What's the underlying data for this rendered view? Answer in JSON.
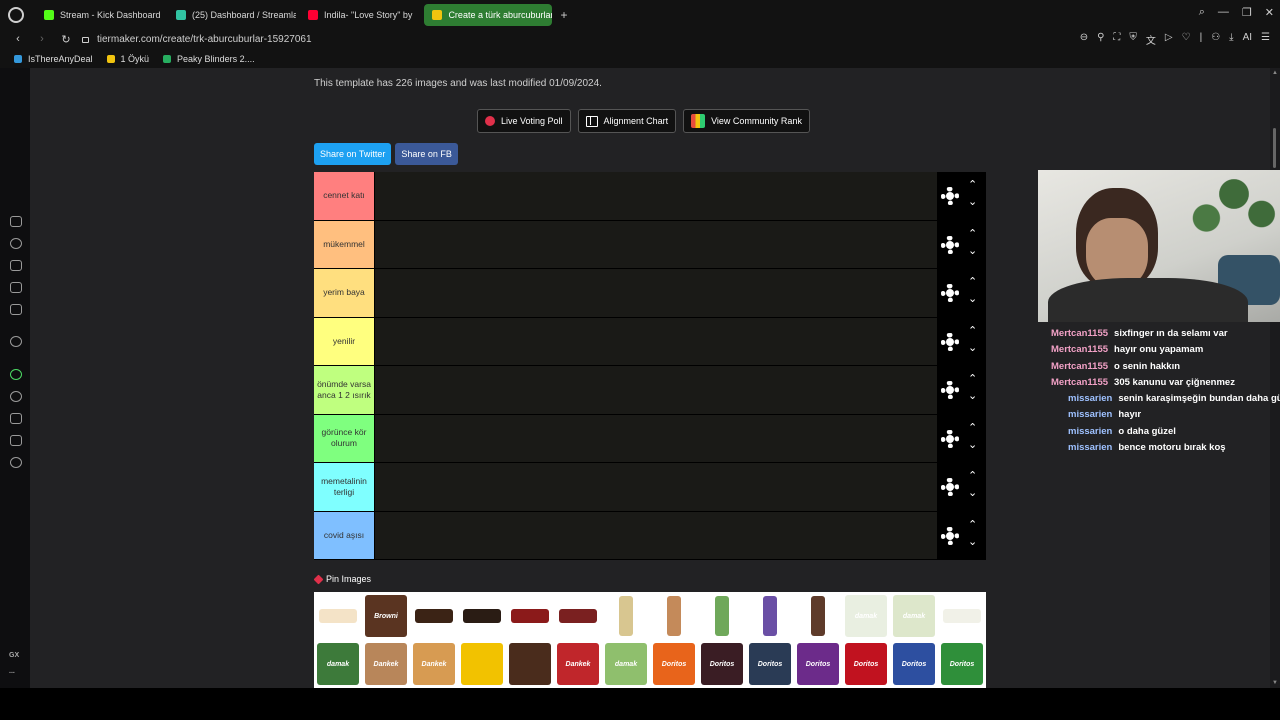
{
  "browser": {
    "tabs": [
      {
        "label": "Stream - Kick Dashboard",
        "color": "#53fc18",
        "active": false
      },
      {
        "label": "(25) Dashboard / Streamlabs",
        "color": "#31c3a2",
        "active": false
      },
      {
        "label": "Indila- \"Love Story\" by",
        "color": "#ff0033",
        "active": false
      },
      {
        "label": "Create a türk aburcuburlar",
        "color": "#f1c40f",
        "active": true
      }
    ],
    "new_tab": "+",
    "url": "tiermaker.com/create/trk-aburcuburlar-15927061",
    "ai_label": "AI",
    "bookmarks": [
      {
        "label": "IsThereAnyDeal",
        "color": "#3498db"
      },
      {
        "label": "1 Öykü",
        "color": "#f1c40f"
      },
      {
        "label": "Peaky Blinders 2....",
        "color": "#27ae60"
      }
    ]
  },
  "sidebar": {
    "gx_label": "GX",
    "more_label": "..."
  },
  "page": {
    "info_text": "This template has 226 images and was last modified 01/09/2024.",
    "buttons": {
      "live_voting": "Live Voting Poll",
      "alignment": "Alignment Chart",
      "community_rank": "View Community Rank"
    },
    "share": {
      "twitter": "Share on Twitter",
      "facebook": "Share on FB"
    },
    "tiers": [
      {
        "label": "cennet katı",
        "color": "#ff7f7f"
      },
      {
        "label": "mükemmel",
        "color": "#ffbf7f"
      },
      {
        "label": "yerim baya",
        "color": "#ffdf7f"
      },
      {
        "label": "yenilir",
        "color": "#ffff7f"
      },
      {
        "label": "önümde varsa anca 1 2 ısırık",
        "color": "#bfff7f"
      },
      {
        "label": "görünce kör olurum",
        "color": "#7fff7f"
      },
      {
        "label": "memetalinin terligi",
        "color": "#7fffff"
      },
      {
        "label": "covid aşısı",
        "color": "#7fbfff"
      }
    ],
    "tier_controls": {
      "up": "⌃",
      "down": "⌄"
    },
    "pin_label": "Pin Images",
    "images": [
      {
        "name": "wafer-bar-image",
        "bg": "#f4e3c7",
        "label": ""
      },
      {
        "name": "browni-image",
        "bg": "#5a3421",
        "label": "Browni"
      },
      {
        "name": "chocolate-bar-image",
        "bg": "#3b2315",
        "label": ""
      },
      {
        "name": "dark-bar-image",
        "bg": "#2a1c14",
        "label": ""
      },
      {
        "name": "red-bar-image",
        "bg": "#8b1a1a",
        "label": ""
      },
      {
        "name": "small-bar-image",
        "bg": "#7a2020",
        "label": ""
      },
      {
        "name": "cone-image",
        "bg": "#d8c690",
        "label": ""
      },
      {
        "name": "cone-two-image",
        "bg": "#c48a5a",
        "label": ""
      },
      {
        "name": "green-cone-image",
        "bg": "#6fa85a",
        "label": ""
      },
      {
        "name": "purple-cone-image",
        "bg": "#6a4fa5",
        "label": ""
      },
      {
        "name": "brown-cone-image",
        "bg": "#5e3b2a",
        "label": ""
      },
      {
        "name": "damak-box-image",
        "bg": "#e9efe1",
        "label": "damak"
      },
      {
        "name": "damak-pistachio-image",
        "bg": "#dde7cb",
        "label": "damak"
      },
      {
        "name": "white-bar-image",
        "bg": "#f1f1e8",
        "label": ""
      },
      {
        "name": "damak-bar-image",
        "bg": "#3d7a3a",
        "label": "damak"
      },
      {
        "name": "dankek-image",
        "bg": "#b8865a",
        "label": "Dankek"
      },
      {
        "name": "dankek-two-image",
        "bg": "#d79b52",
        "label": "Dankek"
      },
      {
        "name": "yellow-pack-image",
        "bg": "#f2c200",
        "label": ""
      },
      {
        "name": "ozmo-image",
        "bg": "#4a2c1c",
        "label": ""
      },
      {
        "name": "dankek-red-image",
        "bg": "#c0262b",
        "label": "Dankek"
      },
      {
        "name": "damak-green-image",
        "bg": "#8fbf6d",
        "label": "damak"
      },
      {
        "name": "doritos-orange-image",
        "bg": "#e8641b",
        "label": "Doritos"
      },
      {
        "name": "doritos-dark-image",
        "bg": "#3a1d24",
        "label": "Doritos"
      },
      {
        "name": "doritos-extreme-image",
        "bg": "#2a3b55",
        "label": "Doritos"
      },
      {
        "name": "doritos-purple-image",
        "bg": "#6c2b8a",
        "label": "Doritos"
      },
      {
        "name": "doritos-red-image",
        "bg": "#c1121f",
        "label": "Doritos"
      },
      {
        "name": "doritos-blue-image",
        "bg": "#2d4fa0",
        "label": "Doritos"
      },
      {
        "name": "doritos-green-image",
        "bg": "#2f8f3a",
        "label": "Doritos"
      }
    ]
  },
  "chat": [
    {
      "user": "Mertcan1155",
      "text": "sixfinger ın da selamı var",
      "color": "#f2a1c6"
    },
    {
      "user": "Mertcan1155",
      "text": "hayır onu yapamam",
      "color": "#f2a1c6"
    },
    {
      "user": "Mertcan1155",
      "text": "o senin hakkın",
      "color": "#f2a1c6"
    },
    {
      "user": "Mertcan1155",
      "text": "305 kanunu var çiğnenmez",
      "color": "#f2a1c6"
    },
    {
      "user": "missarien",
      "text": "senin karaşimşeğin bundan daha gü",
      "color": "#9ec1ff"
    },
    {
      "user": "missarien",
      "text": "hayır",
      "color": "#9ec1ff"
    },
    {
      "user": "missarien",
      "text": "o daha güzel",
      "color": "#9ec1ff"
    },
    {
      "user": "missarien",
      "text": "bence motoru bırak koş",
      "color": "#9ec1ff"
    }
  ]
}
